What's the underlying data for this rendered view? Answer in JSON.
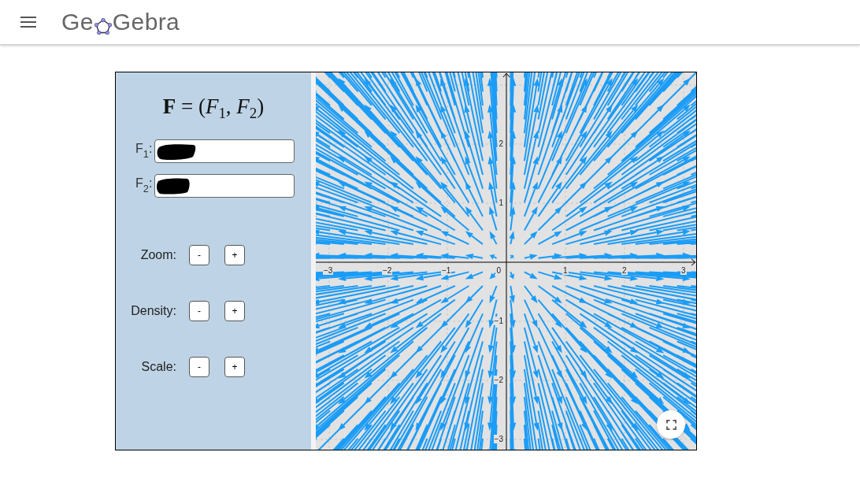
{
  "header": {
    "logo_start": "Ge",
    "logo_end": "Gebra"
  },
  "panel": {
    "formula": "**F** = (*F*$_{1}$, *F*$_{2}$)",
    "fields": [
      {
        "label": "F$_{1}$:",
        "redacted": true
      },
      {
        "label": "F$_{2}$:",
        "redacted": true
      }
    ],
    "controls": [
      {
        "label": "Zoom:",
        "buttons": [
          "-",
          "+"
        ]
      },
      {
        "label": "Density:",
        "buttons": [
          "-",
          "+"
        ]
      },
      {
        "label": "Scale:",
        "buttons": [
          "-",
          "+"
        ]
      }
    ]
  },
  "graph": {
    "x_tick_labels_negative": [
      "−3",
      "−2",
      "−1"
    ],
    "origin_label": "0",
    "x_tick_labels_positive": [
      "1",
      "2",
      "3"
    ],
    "y_tick_labels_positive": [
      "2",
      "1"
    ],
    "y_tick_labels_negative": [
      "−1",
      "−2",
      "−3"
    ]
  }
}
